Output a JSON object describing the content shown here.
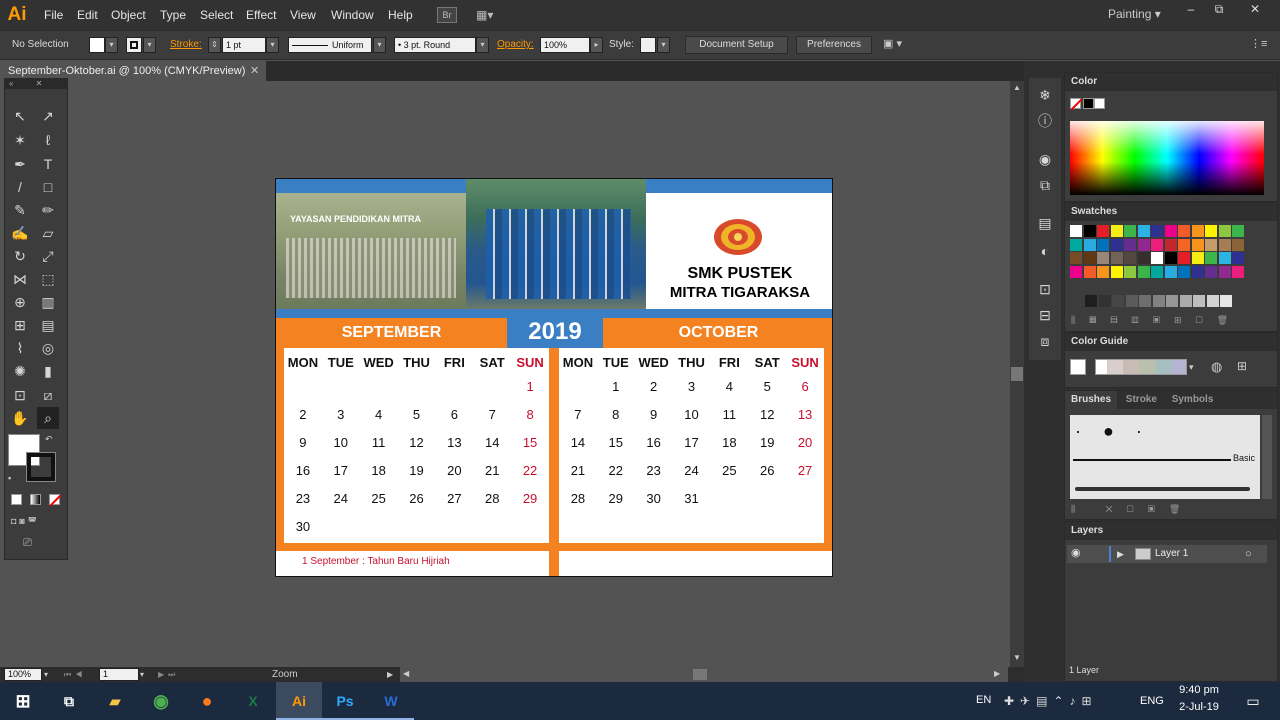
{
  "app": {
    "logo": "Ai",
    "menu": [
      "File",
      "Edit",
      "Object",
      "Type",
      "Select",
      "Effect",
      "View",
      "Window",
      "Help"
    ],
    "bridge_label": "Br",
    "workspace": "Painting",
    "window_controls": [
      "–",
      "⧉",
      "✕"
    ]
  },
  "controlbar": {
    "selection": "No Selection",
    "stroke_label": "Stroke:",
    "stroke_weight": "1 pt",
    "stroke_profile": "Uniform",
    "brush_def": "3 pt. Round",
    "opacity_label": "Opacity:",
    "opacity_value": "100%",
    "style_label": "Style:",
    "document_setup": "Document Setup",
    "preferences": "Preferences"
  },
  "document": {
    "tab_title": "September-Oktober.ai @ 100% (CMYK/Preview)",
    "zoom": "100%",
    "artboard_number": "1",
    "status": "Zoom"
  },
  "calendar": {
    "foundation": "YAYASAN PENDIDIKAN MITRA",
    "school_line1": "SMK PUSTEK",
    "school_line2": "MITRA TIGARAKSA",
    "year": "2019",
    "left_month": "SEPTEMBER",
    "right_month": "OCTOBER",
    "weekdays": [
      "MON",
      "TUE",
      "WED",
      "THU",
      "FRI",
      "SAT",
      "SUN"
    ],
    "september_rows": [
      [
        "",
        "",
        "",
        "",
        "",
        "",
        "1"
      ],
      [
        "2",
        "3",
        "4",
        "5",
        "6",
        "7",
        "8"
      ],
      [
        "9",
        "10",
        "11",
        "12",
        "13",
        "14",
        "15"
      ],
      [
        "16",
        "17",
        "18",
        "19",
        "20",
        "21",
        "22"
      ],
      [
        "23",
        "24",
        "25",
        "26",
        "27",
        "28",
        "29"
      ],
      [
        "30",
        "",
        "",
        "",
        "",
        "",
        ""
      ]
    ],
    "october_rows": [
      [
        "",
        "1",
        "2",
        "3",
        "4",
        "5",
        "6"
      ],
      [
        "7",
        "8",
        "9",
        "10",
        "11",
        "12",
        "13"
      ],
      [
        "14",
        "15",
        "16",
        "17",
        "18",
        "19",
        "20"
      ],
      [
        "21",
        "22",
        "23",
        "24",
        "25",
        "26",
        "27"
      ],
      [
        "28",
        "29",
        "30",
        "31",
        "",
        "",
        ""
      ]
    ],
    "holiday_note": "1 September : Tahun Baru Hijriah",
    "colors": {
      "orange": "#f58220",
      "blue": "#3a7fc4",
      "navy": "#1b4a8a",
      "red": "#c8102e"
    }
  },
  "panels": {
    "color": "Color",
    "swatches": "Swatches",
    "color_guide": "Color Guide",
    "brushes_tabs": [
      "Brushes",
      "Stroke",
      "Symbols"
    ],
    "brush_basic": "Basic",
    "layers": "Layers",
    "layer_name": "Layer 1",
    "layer_count": "1 Layer"
  },
  "taskbar": {
    "lang": "EN",
    "input": "ENG",
    "time": "9:40 pm",
    "date": "2-Jul-19"
  }
}
